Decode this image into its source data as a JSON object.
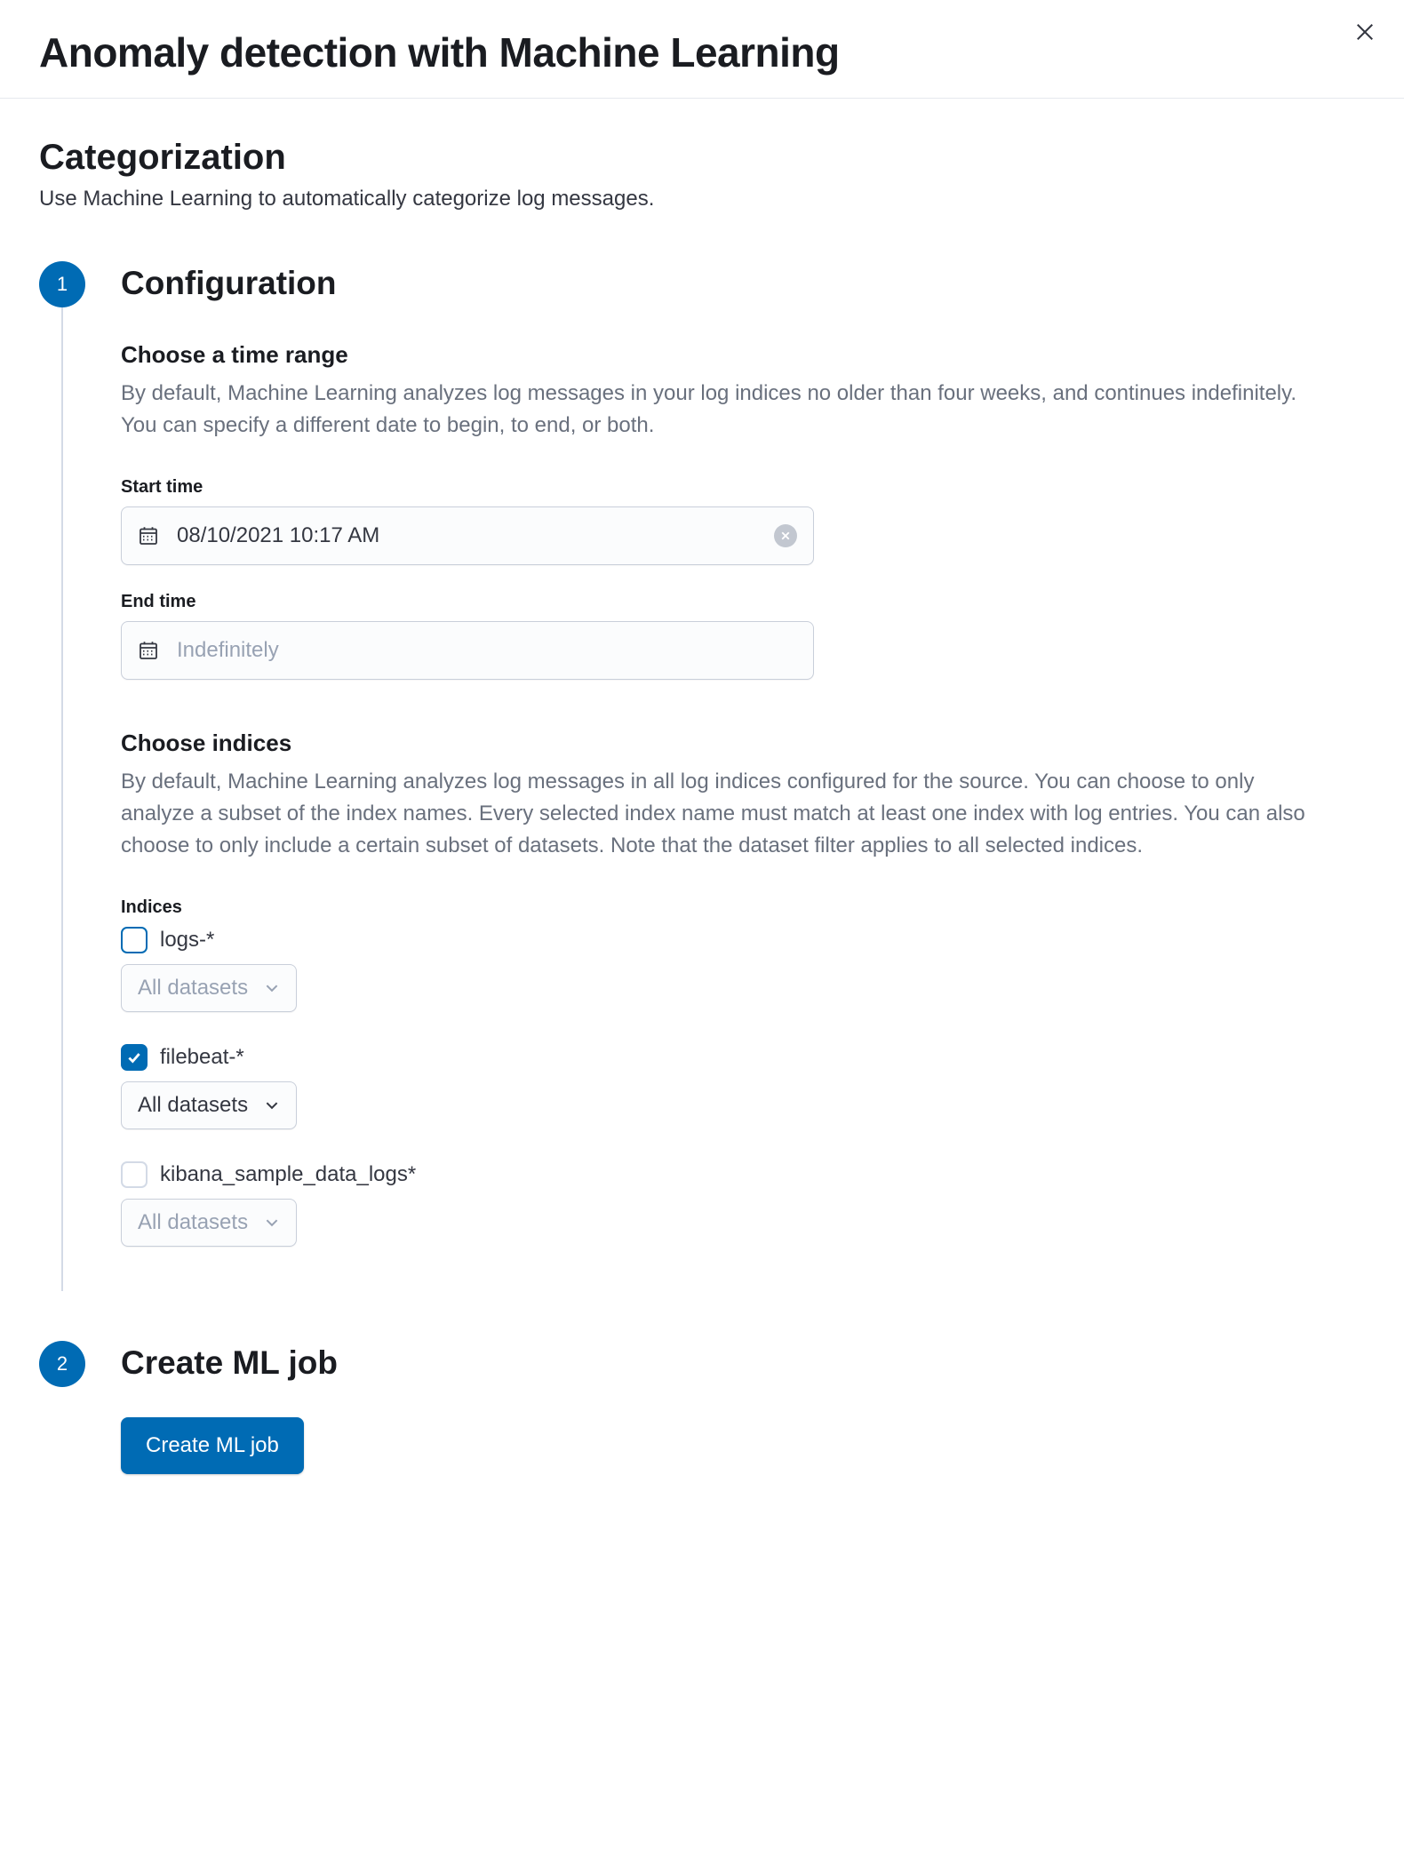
{
  "header": {
    "title": "Anomaly detection with Machine Learning"
  },
  "section": {
    "title": "Categorization",
    "description": "Use Machine Learning to automatically categorize log messages."
  },
  "steps": {
    "config": {
      "number": "1",
      "title": "Configuration",
      "timerange": {
        "title": "Choose a time range",
        "description": "By default, Machine Learning analyzes log messages in your log indices no older than four weeks, and continues indefinitely. You can specify a different date to begin, to end, or both.",
        "start_label": "Start time",
        "start_value": "08/10/2021 10:17 AM",
        "end_label": "End time",
        "end_placeholder": "Indefinitely"
      },
      "indices": {
        "title": "Choose indices",
        "description": "By default, Machine Learning analyzes log messages in all log indices configured for the source. You can choose to only analyze a subset of the index names. Every selected index name must match at least one index with log entries. You can also choose to only include a certain subset of datasets. Note that the dataset filter applies to all selected indices.",
        "label": "Indices",
        "items": [
          {
            "name": "logs-*",
            "checked": false,
            "datasets_label": "All datasets",
            "enabled": false
          },
          {
            "name": "filebeat-*",
            "checked": true,
            "datasets_label": "All datasets",
            "enabled": true
          },
          {
            "name": "kibana_sample_data_logs*",
            "checked": false,
            "datasets_label": "All datasets",
            "enabled": false
          }
        ]
      }
    },
    "create": {
      "number": "2",
      "title": "Create ML job",
      "button": "Create ML job"
    }
  }
}
